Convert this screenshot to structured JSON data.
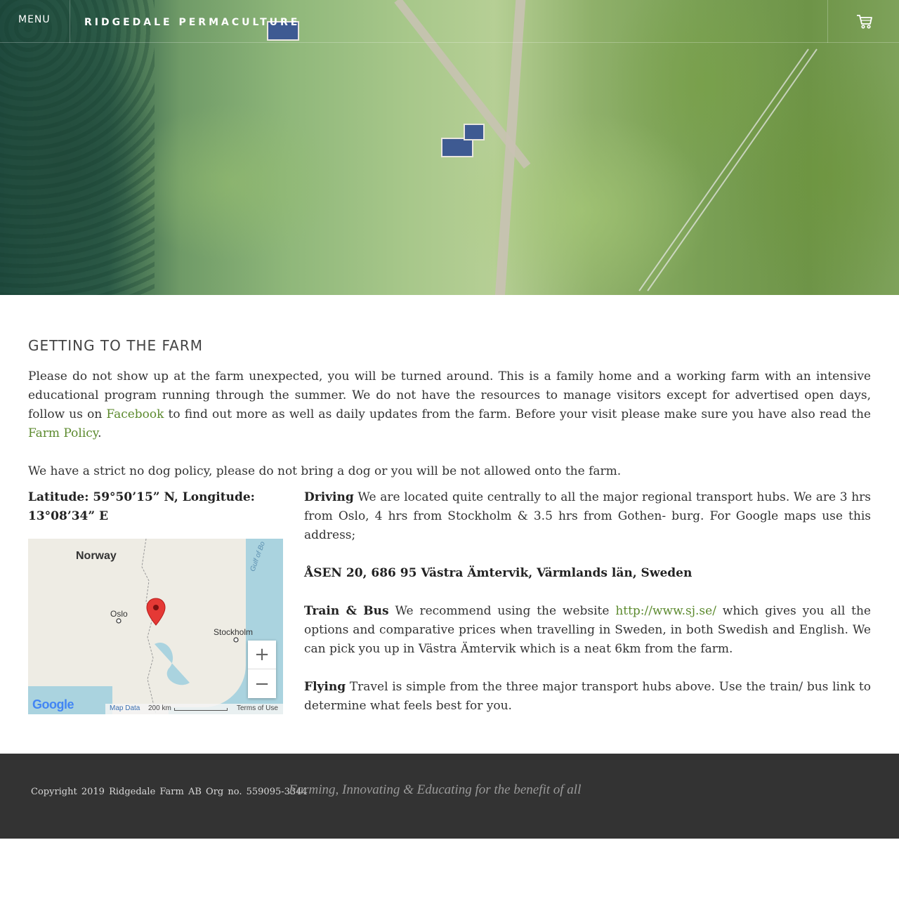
{
  "header": {
    "menu_label": "MENU",
    "site_title": "RIDGEDALE PERMACULTURE",
    "cart_icon": "cart-icon"
  },
  "main": {
    "title": "GETTING TO THE FARM",
    "intro": {
      "part1": "Please do not show up at the farm unexpected, you will be turned around.  This is a family home and a working farm with an intensive educational program running through the summer.  We do not have the resources to manage visitors except for advertised open days, follow us on ",
      "facebook_link": "Facebook",
      "part2": " to find out more as well as daily updates from the farm.  Before your visit please make sure you have also read the ",
      "policy_link": "Farm Policy",
      "part3": "."
    },
    "dog_policy": "We have a strict no dog policy, please do not bring a dog or you will be not allowed onto the farm.",
    "coordinates": "Latitude: 59°50’15” N, Longitude: 13°08’34” E",
    "map": {
      "labels": {
        "norway": "Norway",
        "oslo": "Oslo",
        "stockholm": "Stockholm",
        "gulf": "Gulf of Bo"
      },
      "zoom_in": "+",
      "zoom_out": "−",
      "logo": "Google",
      "map_data": "Map Data",
      "scale": "200 km",
      "terms": "Terms of Use"
    },
    "driving": {
      "label": "Driving",
      "text": " We are located quite centrally to all the major regional transport hubs. We are 3 hrs from Oslo, 4 hrs from Stockholm & 3.5 hrs from Gothen- burg. For Google maps use this address;"
    },
    "address": "ÅSEN 20, 686 95 Västra Ämtervik, Värmlands län, Sweden",
    "train": {
      "label": "Train & Bus",
      "text1": " We recommend using the website ",
      "link": "http://www.sj.se/",
      "text2": " which gives you all the options and comparative prices when travelling in Sweden, in both Swedish and English. We can pick you up in Västra Ämtervik which is a neat 6km from the farm."
    },
    "flying": {
      "label": "Flying",
      "text": " Travel is simple from the three major transport hubs above. Use the train/ bus link to determine what feels best for you."
    }
  },
  "footer": {
    "copyright": "Copyright 2019    Ridgedale Farm AB    Org no. 559095-3344",
    "tagline": "Farming, Innovating & Educating for the benefit of all"
  },
  "colors": {
    "link": "#5c8a2e",
    "footer_bg": "#333333",
    "map_marker": "#e53935",
    "map_water": "#aad3df"
  }
}
